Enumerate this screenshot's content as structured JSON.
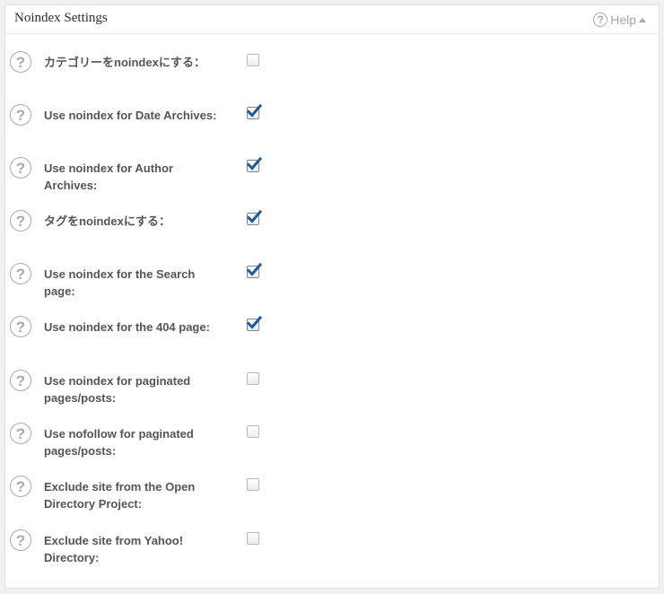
{
  "panel": {
    "title": "Noindex Settings",
    "help_label": "Help"
  },
  "settings": [
    {
      "label": "カテゴリーをnoindexにする：",
      "checked": false
    },
    {
      "label": "Use noindex for Date Archives:",
      "checked": true
    },
    {
      "label": "Use noindex for Author Archives:",
      "checked": true
    },
    {
      "label": "タグをnoindexにする：",
      "checked": true
    },
    {
      "label": "Use noindex for the Search page:",
      "checked": true
    },
    {
      "label": "Use noindex for the 404 page:",
      "checked": true
    },
    {
      "label": "Use noindex for paginated pages/posts:",
      "checked": false
    },
    {
      "label": "Use nofollow for paginated pages/posts:",
      "checked": false
    },
    {
      "label": "Exclude site from the Open Directory Project:",
      "checked": false
    },
    {
      "label": "Exclude site from Yahoo! Directory:",
      "checked": false
    }
  ],
  "colors": {
    "check_mark": "#1e5a9a",
    "help_icon": "#a9a9a9"
  }
}
